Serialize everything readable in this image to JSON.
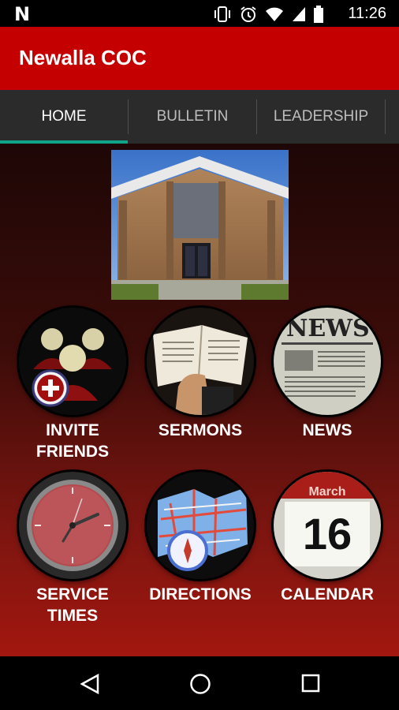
{
  "status_bar": {
    "time": "11:26",
    "left_logo": "N"
  },
  "app_bar": {
    "title": "Newalla COC"
  },
  "tabs": [
    {
      "label": "HOME",
      "active": true
    },
    {
      "label": "BULLETIN",
      "active": false
    },
    {
      "label": "LEADERSHIP",
      "active": false
    }
  ],
  "grid": [
    {
      "label": "INVITE FRIENDS",
      "icon": "invite-friends-icon"
    },
    {
      "label": "SERMONS",
      "icon": "bible-icon"
    },
    {
      "label": "NEWS",
      "icon": "newspaper-icon"
    },
    {
      "label": "SERVICE TIMES",
      "icon": "clock-icon"
    },
    {
      "label": "DIRECTIONS",
      "icon": "map-compass-icon"
    },
    {
      "label": "CALENDAR",
      "icon": "calendar-icon",
      "calendar_month": "March",
      "calendar_day": "16"
    }
  ],
  "colors": {
    "app_bar": "#c50000",
    "tab_indicator": "#10a58b",
    "tab_bar": "#2b2b2b"
  }
}
